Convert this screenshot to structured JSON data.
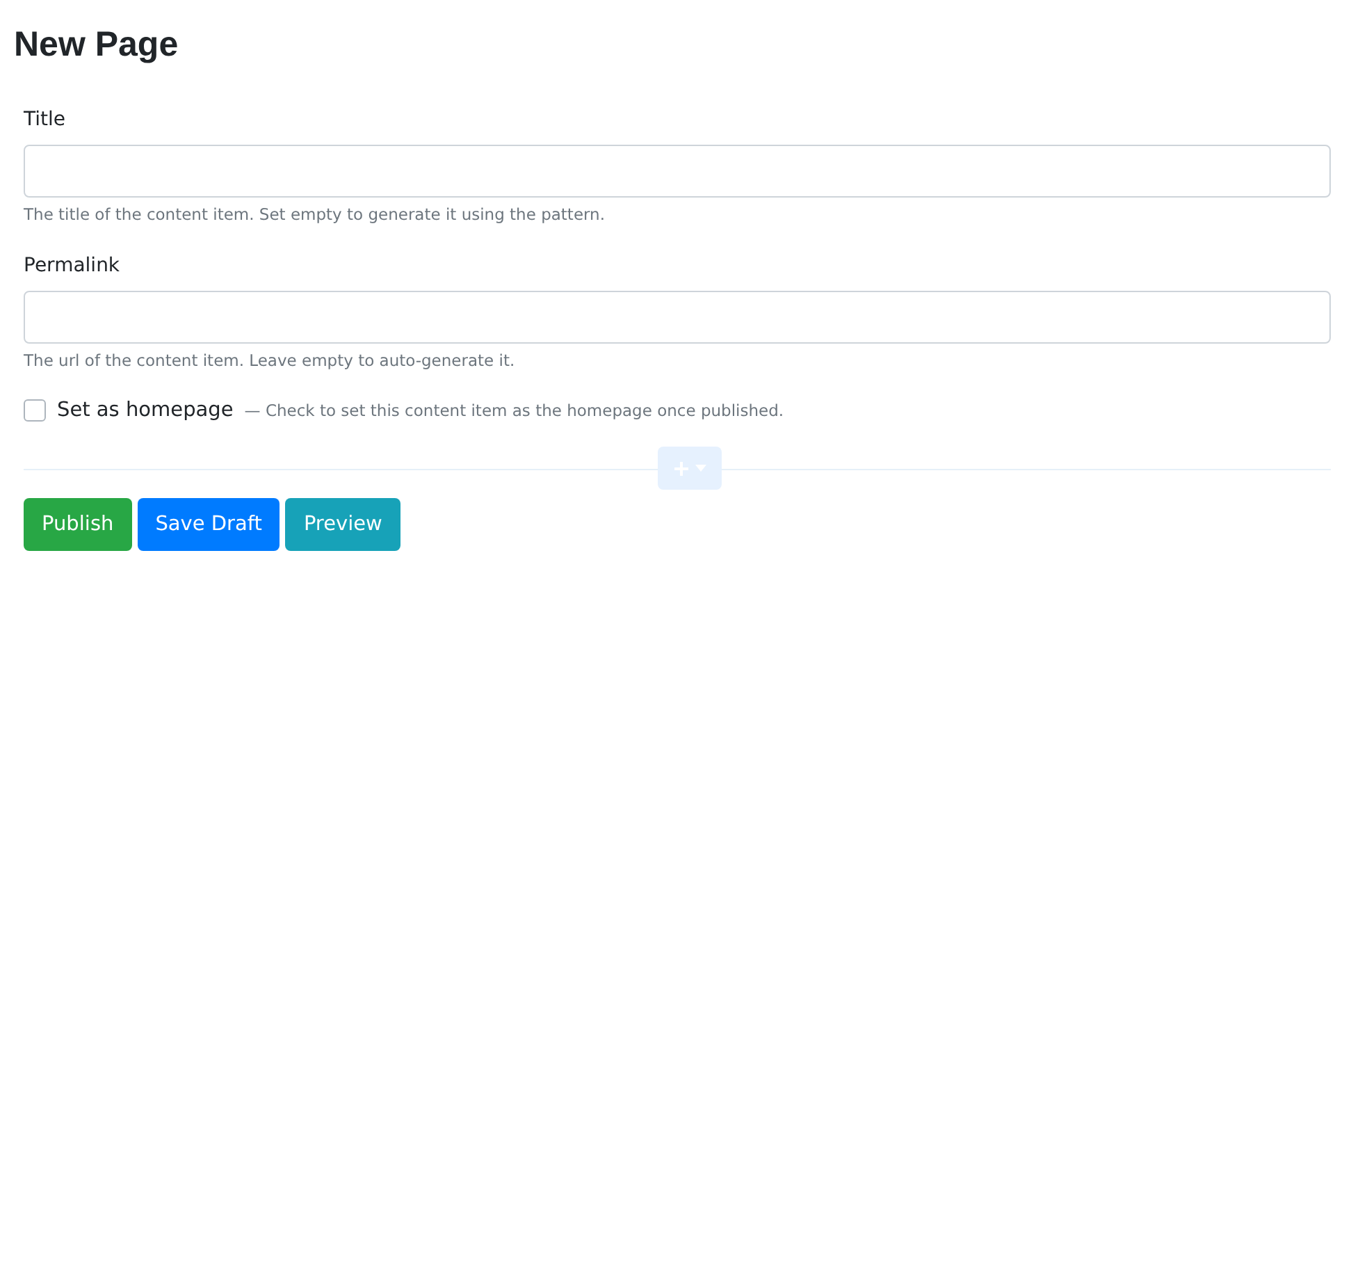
{
  "heading": "New Page",
  "fields": [
    {
      "label": "Title",
      "help": "The title of the content item. Set empty to generate it using the pattern."
    },
    {
      "label": "Permalink",
      "help": "The url of the content item. Leave empty to auto-generate it."
    }
  ],
  "homepage": {
    "label": "Set as homepage",
    "hint": "— Check to set this content item as the homepage once published.",
    "checked": false
  },
  "buttons": [
    {
      "label": "Publish",
      "kind": "success"
    },
    {
      "label": "Save Draft",
      "kind": "primary"
    },
    {
      "label": "Preview",
      "kind": "info"
    }
  ]
}
